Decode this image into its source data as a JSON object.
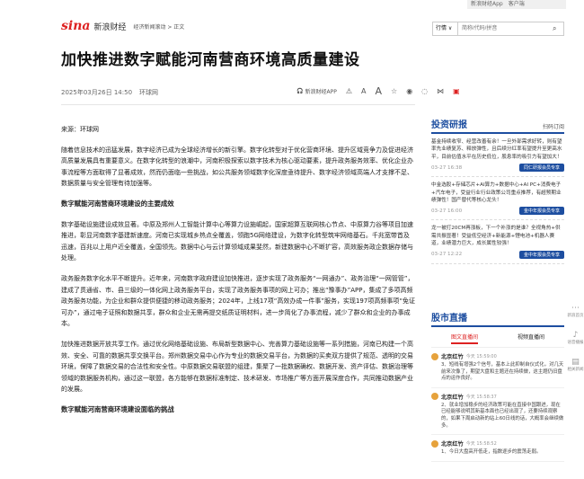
{
  "top": {
    "app": "新浪财经App",
    "extra": "客户端"
  },
  "logo": {
    "brand": "sina",
    "name": "新浪财经"
  },
  "breadcrumb": "经济新闻滚动 > 正文",
  "search": {
    "select": "行情 ∨",
    "placeholder": "简称/代码/拼音"
  },
  "title": "加快推进数字赋能河南营商环境高质量建设",
  "meta": {
    "date": "2025年03月26日 14:50",
    "source": "环球网"
  },
  "tools": {
    "app_label": "新浪财经APP",
    "font_small": "A",
    "font_large": "A"
  },
  "article": {
    "source": "来源：环球网",
    "p1": "随着信息技术的迅猛发展，数字经济已成为全球经济增长的新引擎。数字化转型对于优化营商环境、提升区域竞争力及促进经济高质量发展具有重要意义。在数字化转型的浪潮中，河南积极探索以数字技术为核心驱动要素，提升政务服务效率、优化企业办事流程等方面取得了显著成效，然而仍面临一些挑战，如公共服务领域数字化深度亟待提升、数字经济领域高端人才支撑不足、数据质量与安全管理有待加强等。",
    "h1": "数字赋能河南营商环境建设的主要成效",
    "p2": "数字基础设施建设成效显著。中原及郑州人工智能计算中心等算力设施崛起，国家超算互联网核心节点、中原算力谷等项目加速推进，彰显河南数字基建新速度。河南已实现城乡热点全覆盖，领跑5G网络建设，为数字化转型筑牢网络基石。千兆宽带首及迅速，百兆以上用户近全覆盖，全国领先。数据中心与云计算领域成果斐然，新建数据中心不断扩容，高效服务政企数据存储与处理。",
    "p3": "政务服务数字化水平不断提升。近年来，河南数字政府建设加快推进，逐步实现了政务服务“一网通办”、政务治理“一网管管”，建成了贯通省、市、县三级的一体化网上政务服务平台，实现了政务服务事项的网上可办；推出“豫事办”APP，集成了多项高频政务服务功能，为企业和群众提供便捷的移动政务服务；2024年，上线17项“高效办成一件事”服务，实现197项高频事项“免证可办”，通过电子证照和数据共享，群众和企业无需再提交纸质证明材料，进一步简化了办事流程，减少了群众和企业的办事成本。",
    "p4": "加快推进数据开放共享工作。通过优化网络基础设施、布局新型数据中心、完善算力基础设施等一系列措施，河南已构建一个高效、安全、可靠的数据共享交换平台。郑州数据交易中心作为专业的数据交易平台，为数据的买卖双方提供了规范、透明的交易环境，保障了数据交易的合法性和安全性。中原数据交易联盟的组建，集聚了一批数据确权、数据开发、资产评估、数据治理等领域的数据服务机构，通过这一联盟，各方能够在数据标准制定、技术研发、市场推广等方面开展深度合作，共同推动数据产业的发展。",
    "h2": "数字赋能河南营商环境建设面临的挑战"
  },
  "research": {
    "title": "投资研报",
    "sub": "扫码订阅",
    "items": [
      {
        "text": "基金持续收窄、经营改善有余！一旦外部需求好转，则有望率先业绩复苏、释放弹性，且后续分红率有望提升至更高水平，目前估值水平在历史低位，股息率的吸引力有望加大！",
        "date": "03-27 16:38",
        "btn": "同仁研报会员专享"
      },
      {
        "text": "中金选股+存储芯片+AI算力+数据中心+AI PC+消费电子+汽车电子，受益行业行业政策公司重点推荐，有超预期业绩弹性！国产替代等核心龙头！",
        "date": "03-27 16:00",
        "btn": "金中年报会员专享"
      },
      {
        "text": "龙一被打20CM再涨板，下一个补涨的是谁？全视角热+供需共振显著！受益低空经济+新能源+锂电池+机器人赛道，业绩潜力巨大，成长属性较强！",
        "date": "03-27 12:22",
        "btn": "金中年报会员专享"
      }
    ]
  },
  "live": {
    "title": "股市直播",
    "tab_active": "图文直播间",
    "tab_other": "视频直播间",
    "items": [
      {
        "name": "北京红竹",
        "time": "今天 15:59:00",
        "text": "3、短线有增强2个信号，基本上此抑制自仪式化，对几天前来次像了，期望大盘和主题还在持续做，这主题仍旧盘点的运作良好。"
      },
      {
        "name": "北京红竹",
        "time": "今天 15:58:37",
        "text": "2、就业增加稳步的经济政策可能在直接中国跟进，现在已经能够说明其新基本面也已经出现了，还要持续观察的，如果下周启动新的站上60日线的话，大概率会继续做多。"
      },
      {
        "name": "北京红竹",
        "time": "今天 15:58:52",
        "text": "1、今日大盘高开低走，指数逐步的震荡走弱。"
      }
    ]
  },
  "float": {
    "a": "新浪首页",
    "b": "语音播报",
    "c": "相关新闻",
    "d": "返回顶部"
  }
}
